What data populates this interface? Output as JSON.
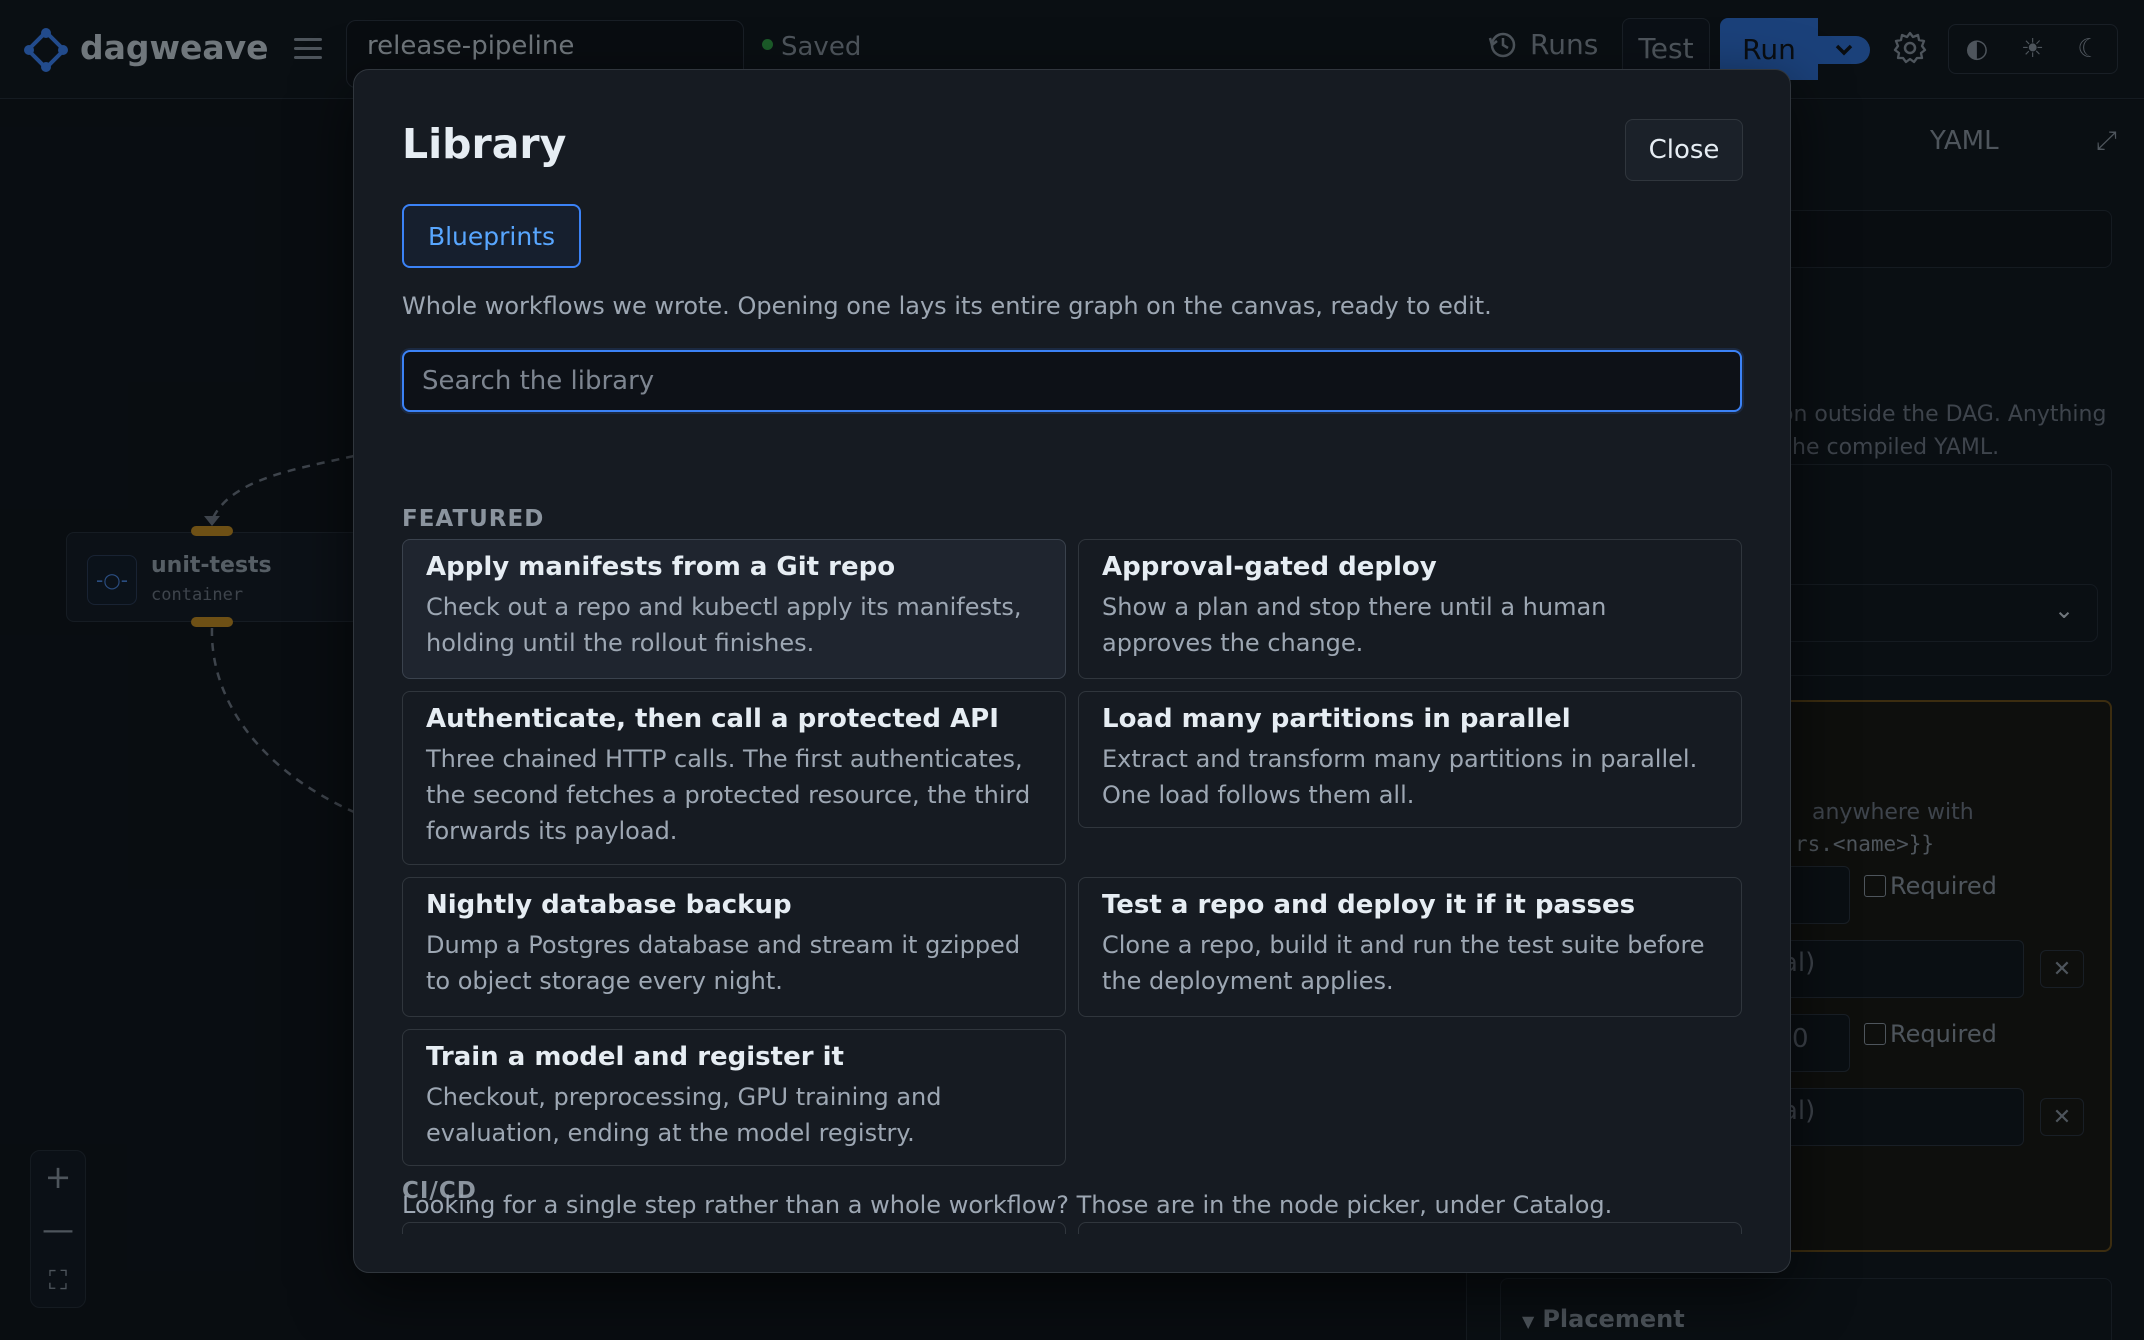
{
  "app": {
    "brand": "dagweave"
  },
  "header": {
    "workflow_name": "release-pipeline",
    "saved_status": "Saved",
    "runs_label": "Runs",
    "test_label": "Test",
    "run_label": "Run",
    "theme_icons": [
      "contrast-icon",
      "sun-icon",
      "moon-icon"
    ]
  },
  "canvas": {
    "node": {
      "title": "unit-tests",
      "type": "container"
    },
    "zoom": {
      "in": "+",
      "out": "—",
      "fit": "⛶"
    }
  },
  "right_panel": {
    "yaml_tab": "YAML",
    "text_fragment_1": "on outside the DAG. Anything",
    "text_fragment_2": "he compiled YAML.",
    "params_text_fragment": "anywhere with",
    "params_code_fragment": "rs.<name>}}",
    "required_label": "Required",
    "field_fragment_al": "al)",
    "field_fragment_0": "0",
    "placement_label": "Placement"
  },
  "modal": {
    "title": "Library",
    "close_label": "Close",
    "tab_label": "Blueprints",
    "description": "Whole workflows we wrote. Opening one lays its entire graph on the canvas, ready to edit.",
    "search_placeholder": "Search the library",
    "sections": {
      "featured": "FEATURED",
      "cicd": "CI/CD"
    },
    "featured_cards": [
      {
        "title": "Apply manifests from a Git repo",
        "desc": "Check out a repo and kubectl apply its manifests, holding until the rollout finishes."
      },
      {
        "title": "Approval-gated deploy",
        "desc": "Show a plan and stop there until a human approves the change."
      },
      {
        "title": "Authenticate, then call a protected API",
        "desc": "Three chained HTTP calls. The first authenticates, the second fetches a protected resource, the third forwards its payload."
      },
      {
        "title": "Load many partitions in parallel",
        "desc": "Extract and transform many partitions in parallel. One load follows them all."
      },
      {
        "title": "Nightly database backup",
        "desc": "Dump a Postgres database and stream it gzipped to object storage every night."
      },
      {
        "title": "Test a repo and deploy it if it passes",
        "desc": "Clone a repo, build it and run the test suite before the deployment applies."
      },
      {
        "title": "Train a model and register it",
        "desc": "Checkout, preprocessing, GPU training and evaluation, ending at the model registry."
      }
    ],
    "footer": "Looking for a single step rather than a whole workflow? Those are in the node picker, under Catalog."
  }
}
